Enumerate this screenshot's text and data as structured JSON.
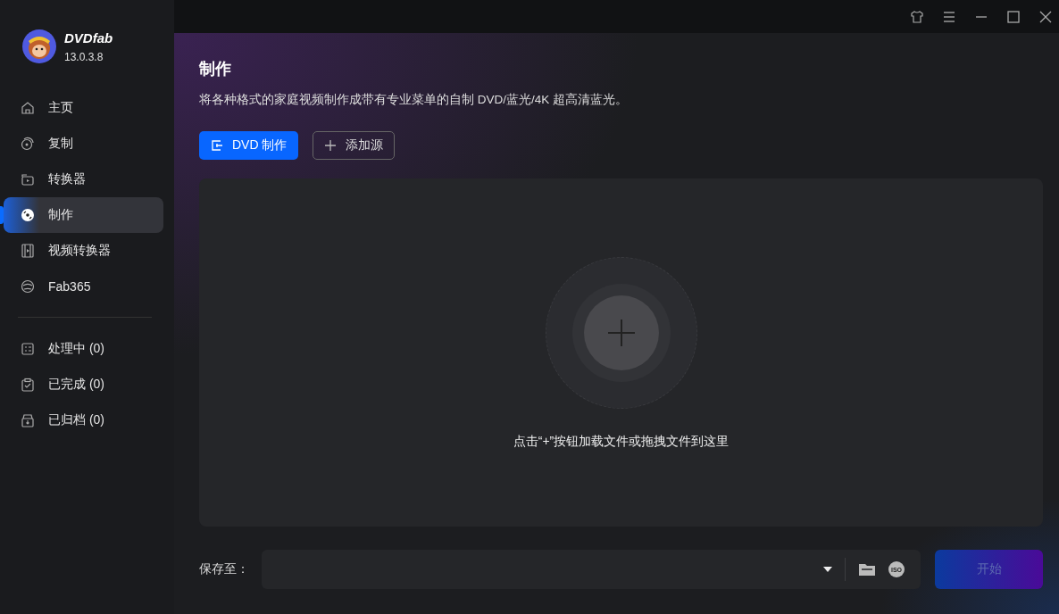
{
  "app": {
    "name": "DVDfab",
    "version": "13.0.3.8"
  },
  "nav": [
    {
      "label": "主页",
      "selected": false
    },
    {
      "label": "复制",
      "selected": false
    },
    {
      "label": "转换器",
      "selected": false
    },
    {
      "label": "制作",
      "selected": true
    },
    {
      "label": "视频转换器",
      "selected": false
    },
    {
      "label": "Fab365",
      "selected": false
    }
  ],
  "queues": [
    {
      "label": "处理中 (0)"
    },
    {
      "label": "已完成 (0)"
    },
    {
      "label": "已归档 (0)"
    }
  ],
  "page": {
    "title": "制作",
    "description": "将各种格式的家庭视频制作成带有专业菜单的自制 DVD/蓝光/4K 超高清蓝光。",
    "mode_button": "DVD 制作",
    "add_button": "添加源",
    "drop_hint": "点击“+”按钮加载文件或拖拽文件到这里"
  },
  "footer": {
    "save_label": "保存至：",
    "iso_label": "ISO",
    "start_button": "开始",
    "start_disabled": true
  }
}
